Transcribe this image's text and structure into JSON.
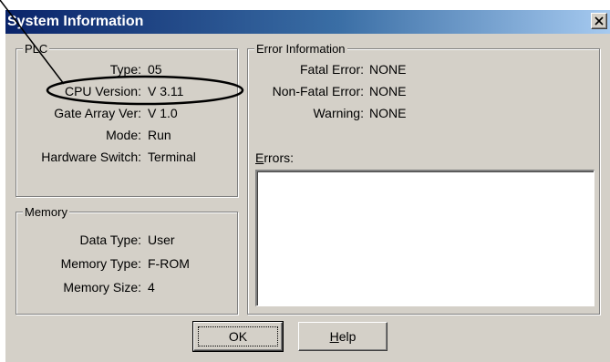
{
  "window": {
    "title": "System Information"
  },
  "plc": {
    "title": "PLC",
    "rows": [
      {
        "label": "Type:",
        "value": "05"
      },
      {
        "label": "CPU Version:",
        "value": "V 3.11"
      },
      {
        "label": "Gate Array Ver:",
        "value": "V 1.0"
      },
      {
        "label": "Mode:",
        "value": "Run"
      },
      {
        "label": "Hardware Switch:",
        "value": "Terminal"
      }
    ]
  },
  "memory": {
    "title": "Memory",
    "rows": [
      {
        "label": "Data Type:",
        "value": "User"
      },
      {
        "label": "Memory Type:",
        "value": "F-ROM"
      },
      {
        "label": "Memory Size:",
        "value": "4"
      }
    ]
  },
  "error_info": {
    "title": "Error Information",
    "rows": [
      {
        "label": "Fatal Error:",
        "value": "NONE"
      },
      {
        "label": "Non-Fatal Error:",
        "value": "NONE"
      },
      {
        "label": "Warning:",
        "value": "NONE"
      }
    ],
    "errors_label_accel": "E",
    "errors_label_rest": "rrors:"
  },
  "buttons": {
    "ok": "OK",
    "help_accel": "H",
    "help_rest": "elp"
  },
  "icons": {
    "close": "close-icon"
  },
  "colors": {
    "highlight": "#000000"
  }
}
